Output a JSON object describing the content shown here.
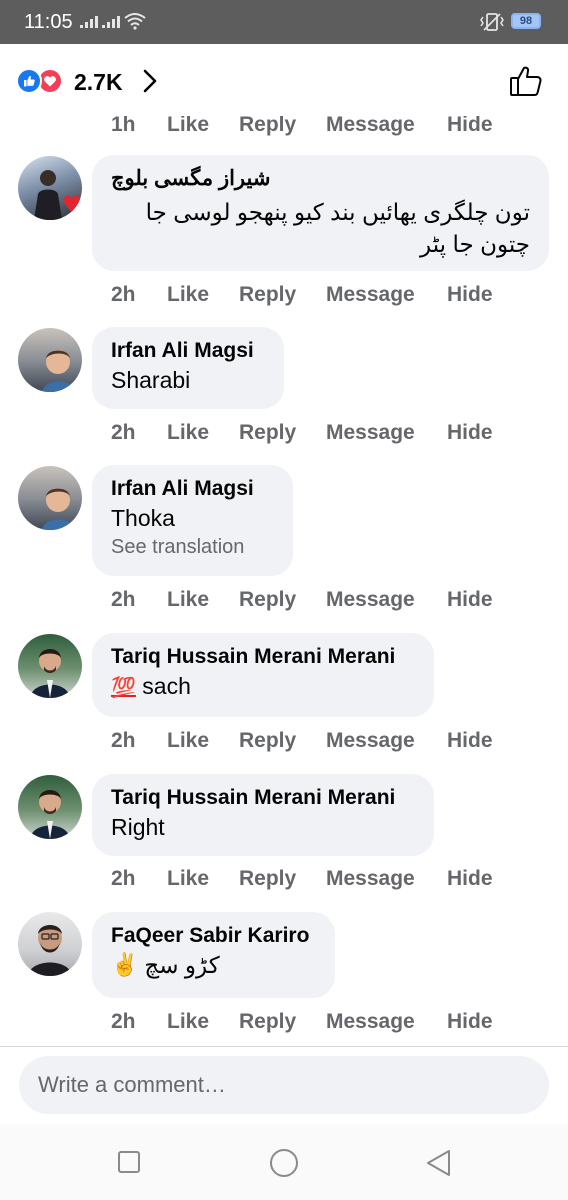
{
  "status_bar": {
    "time": "11:05",
    "battery": "98"
  },
  "post_header": {
    "reaction_count": "2.7K",
    "reactions": [
      "like",
      "love"
    ]
  },
  "partial_actions": {
    "time": "1h",
    "like": "Like",
    "reply": "Reply",
    "message": "Message",
    "hide": "Hide"
  },
  "comments": [
    {
      "author": "شیراز مگسی بلوچ",
      "text_lines": [
        "تون چلگری یھائیں بند کیو پنھجو لوسی جا",
        "چتون جا پٹر"
      ],
      "time": "2h",
      "like": "Like",
      "reply": "Reply",
      "message": "Message",
      "hide": "Hide"
    },
    {
      "author": "Irfan Ali Magsi",
      "text": "Sharabi",
      "time": "2h",
      "like": "Like",
      "reply": "Reply",
      "message": "Message",
      "hide": "Hide"
    },
    {
      "author": "Irfan Ali Magsi",
      "text": "Thoka",
      "translation": "See translation",
      "time": "2h",
      "like": "Like",
      "reply": "Reply",
      "message": "Message",
      "hide": "Hide"
    },
    {
      "author": "Tariq Hussain Merani Merani",
      "emoji": "💯",
      "text": "sach",
      "time": "2h",
      "like": "Like",
      "reply": "Reply",
      "message": "Message",
      "hide": "Hide"
    },
    {
      "author": "Tariq Hussain Merani Merani",
      "text": "Right",
      "time": "2h",
      "like": "Like",
      "reply": "Reply",
      "message": "Message",
      "hide": "Hide"
    },
    {
      "author": "FaQeer Sabir Kariro",
      "text": "کڑو سچ",
      "emoji": "✌️",
      "time": "2h",
      "like": "Like",
      "reply": "Reply",
      "message": "Message",
      "hide": "Hide"
    }
  ],
  "composer": {
    "placeholder": "Write a comment…"
  },
  "colors": {
    "status_bar": "#5d5d5d",
    "bubble": "#f0f2f5",
    "muted_text": "#65676b",
    "like_blue": "#1877f2",
    "love_red": "#f33e58"
  }
}
